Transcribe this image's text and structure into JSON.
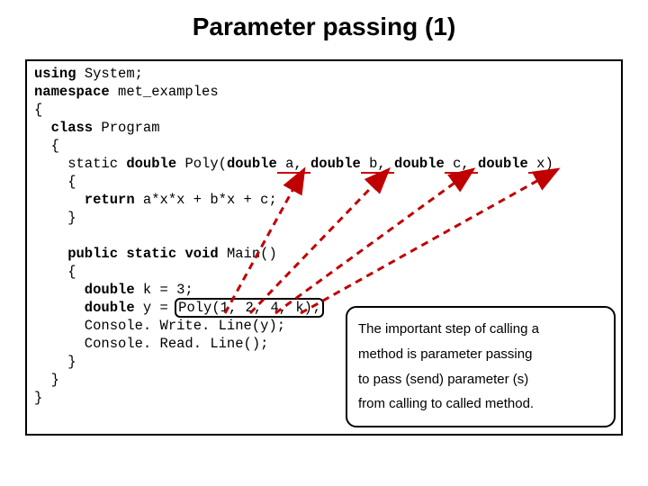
{
  "title": "Parameter passing (1)",
  "code": {
    "l1a": "using",
    "l1b": " System;",
    "l2a": "namespace",
    "l2b": " met_examples",
    "l3": "{",
    "l4a": "  class",
    "l4b": " Program",
    "l5": "  {",
    "l6a": "    static ",
    "l6b": "double",
    "l6c": " Poly(",
    "l6d": "double",
    "l6e": " a, ",
    "l6f": "double",
    "l6g": " b, ",
    "l6h": "double",
    "l6i": " c, ",
    "l6j": "double",
    "l6k": " x)",
    "l7": "    {",
    "l8a": "      return",
    "l8b": " a*x*x + b*x + c;",
    "l9": "    }",
    "l10": " ",
    "l11a": "    public",
    "l11b": " static",
    "l11c": " void",
    "l11d": " Main()",
    "l12": "    {",
    "l13a": "      double",
    "l13b": " k = 3;",
    "l14a": "      double",
    "l14b": " y = ",
    "l14c": "Poly(1, 2, 4, k);",
    "l15": "      Console. Write. Line(y);",
    "l16": "      Console. Read. Line();",
    "l17": "    }",
    "l18": "  }",
    "l19": "}"
  },
  "note": {
    "p1": "The important step of calling a",
    "p2": "method is parameter passing",
    "p3": "to pass (send) parameter (s)",
    "p4": "from calling to called method."
  }
}
